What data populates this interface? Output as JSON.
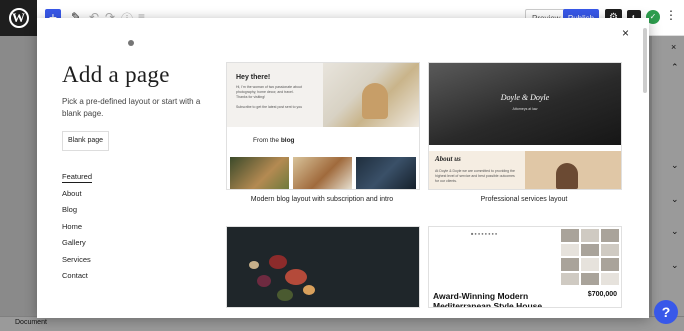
{
  "app": {
    "logo_letter": "W"
  },
  "toolbar": {
    "add_symbol": "+",
    "preview_label": "Preview",
    "publish_label": "Publish",
    "settings_symbol": "⚙",
    "styles_symbol": "◐",
    "plugin_symbol": "✓",
    "more_symbol": "⋮"
  },
  "modal": {
    "title": "Add a page",
    "description": "Pick a pre-defined layout or start with a blank page.",
    "blank_button": "Blank page",
    "close_symbol": "×",
    "categories": [
      {
        "label": "Featured",
        "active": true
      },
      {
        "label": "About",
        "active": false
      },
      {
        "label": "Blog",
        "active": false
      },
      {
        "label": "Home",
        "active": false
      },
      {
        "label": "Gallery",
        "active": false
      },
      {
        "label": "Services",
        "active": false
      },
      {
        "label": "Contact",
        "active": false
      }
    ],
    "layouts": [
      {
        "caption": "Modern blog layout with subscription and intro",
        "heading": "Hey there!",
        "body": "Hi, I'm the woman of two passionate about photography, home decor, and travel. Thanks for visiting!",
        "subscribe": "Subscribe to get the latest post sent to you",
        "section_prefix": "From the ",
        "section_bold": "blog"
      },
      {
        "caption": "Professional services layout",
        "brand": "Doyle & Doyle",
        "tagline": "Attorneys at law",
        "about_heading": "About us",
        "about_text": "At Doyle & Doyle we are committed to providing the highest level of service and best possible outcomes for our clients."
      },
      {
        "caption": ""
      },
      {
        "caption": "",
        "heading": "Award-Winning Modern Mediterranean Style House",
        "price": "$700,000"
      }
    ]
  },
  "sidebar": {
    "chevron": "⌄",
    "collapse": "⌃",
    "close": "×"
  },
  "footer": {
    "status": "Document"
  },
  "help": {
    "symbol": "?"
  }
}
